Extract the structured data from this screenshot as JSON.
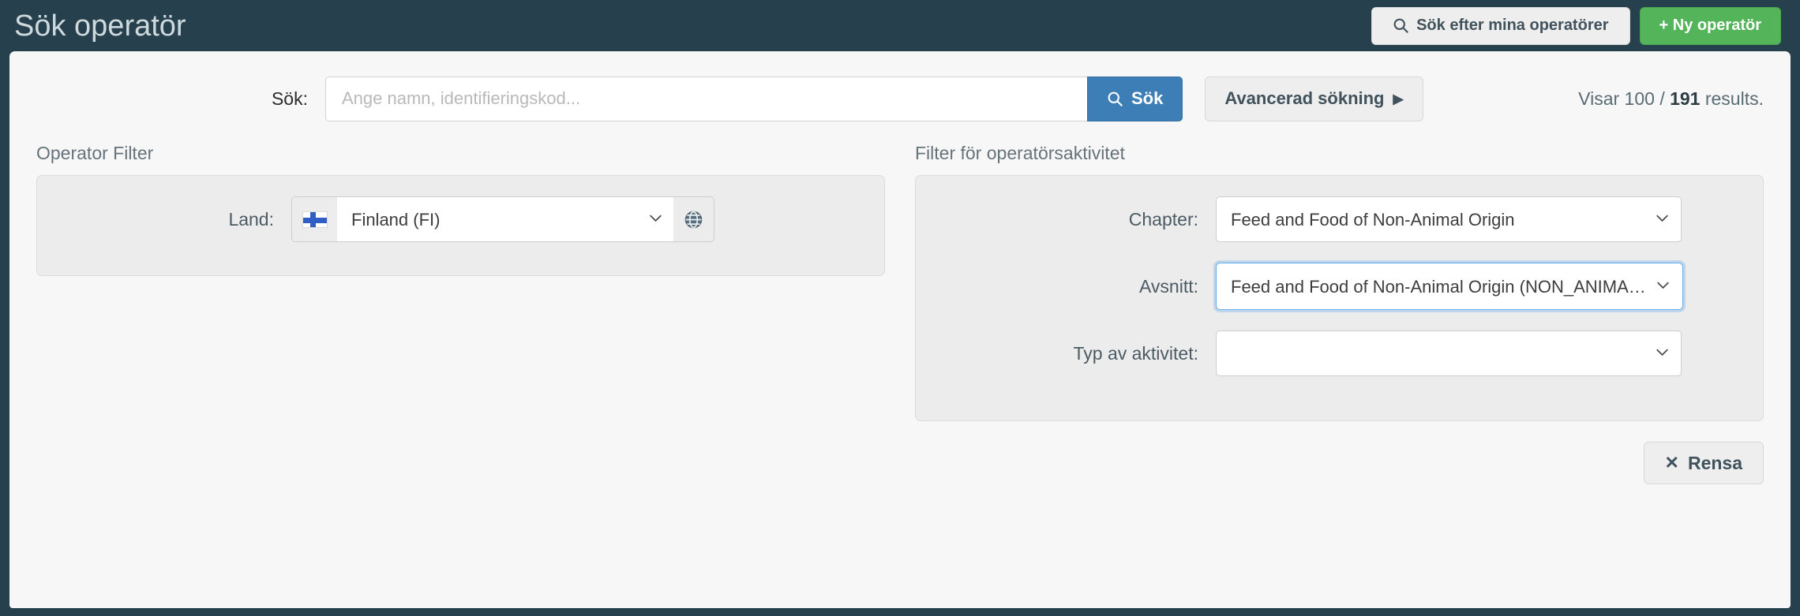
{
  "header": {
    "title": "Sök operatör",
    "my_operators_button": "Sök efter mina operatörer",
    "new_operator_button": "+ Ny operatör"
  },
  "search": {
    "label": "Sök:",
    "placeholder": "Ange namn, identifieringskod...",
    "value": "",
    "search_button": "Sök",
    "advanced_button": "Avancerad sökning",
    "advanced_caret": "▶",
    "results_prefix": "Visar 100 / ",
    "results_count": "191",
    "results_suffix": " results."
  },
  "operator_filter": {
    "heading": "Operator Filter",
    "country": {
      "label": "Land:",
      "flag": "fi-flag-icon",
      "value": "Finland (FI)",
      "globe": "globe-icon"
    }
  },
  "activity_filter": {
    "heading": "Filter för operatörsaktivitet",
    "chapter": {
      "label": "Chapter:",
      "value": "Feed and Food of Non-Animal Origin"
    },
    "section": {
      "label": "Avsnitt:",
      "value": "Feed and Food of Non-Animal Origin (NON_ANIMAL_ORIGIN)",
      "focused": true
    },
    "activity_type": {
      "label": "Typ av aktivitet:",
      "value": ""
    }
  },
  "footer": {
    "clear_button": "Rensa",
    "clear_icon": "✕"
  },
  "colors": {
    "page_background": "#27404d",
    "card_background": "#f7f7f7",
    "panel_background": "#ececec",
    "primary_blue": "#3c7eb5",
    "success_green": "#53b45a",
    "focus_blue": "#66aeea"
  }
}
